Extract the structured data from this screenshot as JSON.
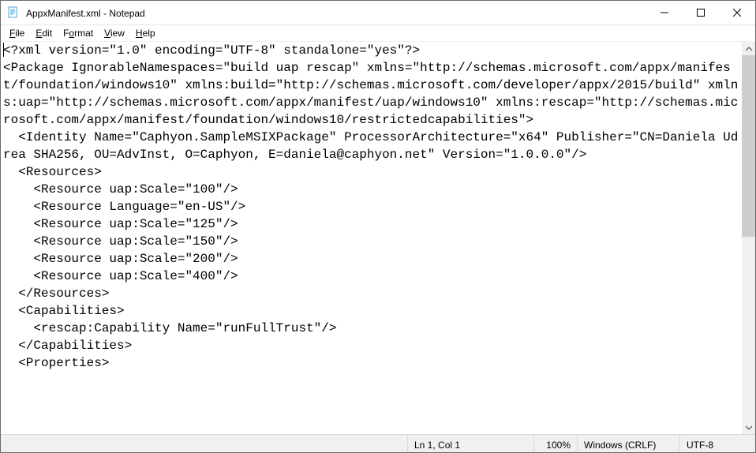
{
  "title": "AppxManifest.xml - Notepad",
  "menu": {
    "file": {
      "pre": "",
      "u": "F",
      "post": "ile"
    },
    "edit": {
      "pre": "",
      "u": "E",
      "post": "dit"
    },
    "format": {
      "pre": "F",
      "u": "o",
      "post": "rmat"
    },
    "view": {
      "pre": "",
      "u": "V",
      "post": "iew"
    },
    "help": {
      "pre": "",
      "u": "H",
      "post": "elp"
    }
  },
  "content": "<?xml version=\"1.0\" encoding=\"UTF-8\" standalone=\"yes\"?>\n<Package IgnorableNamespaces=\"build uap rescap\" xmlns=\"http://schemas.microsoft.com/appx/manifest/foundation/windows10\" xmlns:build=\"http://schemas.microsoft.com/developer/appx/2015/build\" xmlns:uap=\"http://schemas.microsoft.com/appx/manifest/uap/windows10\" xmlns:rescap=\"http://schemas.microsoft.com/appx/manifest/foundation/windows10/restrictedcapabilities\">\n  <Identity Name=\"Caphyon.SampleMSIXPackage\" ProcessorArchitecture=\"x64\" Publisher=\"CN=Daniela Udrea SHA256, OU=AdvInst, O=Caphyon, E=daniela@caphyon.net\" Version=\"1.0.0.0\"/>\n  <Resources>\n    <Resource uap:Scale=\"100\"/>\n    <Resource Language=\"en-US\"/>\n    <Resource uap:Scale=\"125\"/>\n    <Resource uap:Scale=\"150\"/>\n    <Resource uap:Scale=\"200\"/>\n    <Resource uap:Scale=\"400\"/>\n  </Resources>\n  <Capabilities>\n    <rescap:Capability Name=\"runFullTrust\"/>\n  </Capabilities>\n  <Properties>",
  "status": {
    "lncol": "Ln 1, Col 1",
    "zoom": "100%",
    "eol": "Windows (CRLF)",
    "encoding": "UTF-8"
  }
}
